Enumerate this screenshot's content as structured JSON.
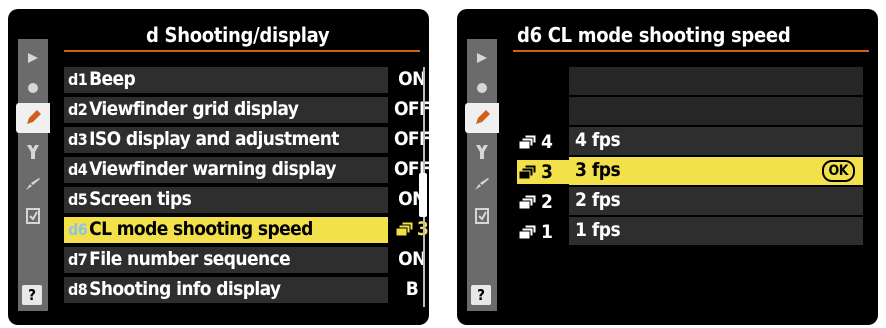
{
  "left": {
    "title": "d  Shooting/display",
    "rows": [
      {
        "code": "d1",
        "label": "Beep",
        "value": "ON"
      },
      {
        "code": "d2",
        "label": "Viewfinder grid display",
        "value": "OFF"
      },
      {
        "code": "d3",
        "label": "ISO display and adjustment",
        "value": "OFF"
      },
      {
        "code": "d4",
        "label": "Viewfinder warning display",
        "value": "OFF"
      },
      {
        "code": "d5",
        "label": "Screen tips",
        "value": "ON"
      },
      {
        "code": "d6",
        "label": "CL mode shooting speed",
        "value": "3"
      },
      {
        "code": "d7",
        "label": "File number sequence",
        "value": "ON"
      },
      {
        "code": "d8",
        "label": "Shooting info display",
        "value": "B"
      }
    ],
    "selected_index": 5
  },
  "right": {
    "title": "d6 CL mode shooting speed",
    "options": [
      {
        "num": "4",
        "label": "4 fps"
      },
      {
        "num": "3",
        "label": "3 fps"
      },
      {
        "num": "2",
        "label": "2 fps"
      },
      {
        "num": "1",
        "label": "1 fps"
      }
    ],
    "selected_index": 1,
    "ok_label": "OK"
  },
  "help_label": "?",
  "icons": [
    "playback-menu-icon",
    "shooting-menu-icon",
    "custom-settings-pencil-icon",
    "setup-wrench-icon",
    "retouch-brush-icon",
    "my-menu-icon",
    "help-icon",
    "continuous-low-icon"
  ],
  "colors": {
    "highlight": "#f2e14a",
    "accent_rule": "#d0601a",
    "row_bg": "#2e2e2e",
    "sidebar": "#6b6b6b"
  }
}
